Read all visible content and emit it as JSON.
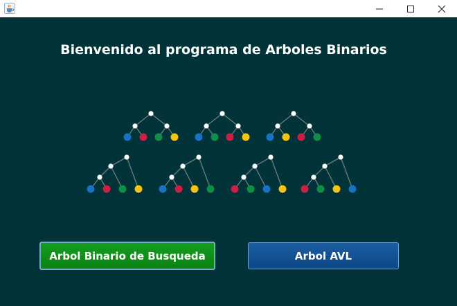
{
  "window": {
    "icon": "java-cup-icon",
    "controls": [
      "minimize-icon",
      "maximize-icon",
      "close-icon"
    ]
  },
  "main": {
    "title": "Bienvenido al programa de Arboles Binarios",
    "buttons": {
      "bst_label": "Arbol Binario de Busqueda",
      "avl_label": "Arbol AVL"
    }
  },
  "colors": {
    "background": "#013339",
    "bst_button": "#0f901a",
    "avl_button": "#124f93",
    "leaf_blue": "#1673c3",
    "leaf_red": "#cc1f45",
    "leaf_green": "#0e8f45",
    "leaf_yellow": "#f4c40f",
    "inner_node": "#ffffff"
  },
  "illustration": {
    "balanced_trees": [
      [
        "blue",
        "red",
        "green",
        "yellow"
      ],
      [
        "blue",
        "green",
        "red",
        "yellow"
      ],
      [
        "blue",
        "yellow",
        "red",
        "green"
      ]
    ],
    "skewed_trees": [
      [
        "blue",
        "red",
        "green",
        "yellow"
      ],
      [
        "blue",
        "red",
        "yellow",
        "green"
      ],
      [
        "red",
        "green",
        "blue",
        "yellow"
      ],
      [
        "red",
        "green",
        "yellow",
        "blue"
      ]
    ]
  }
}
